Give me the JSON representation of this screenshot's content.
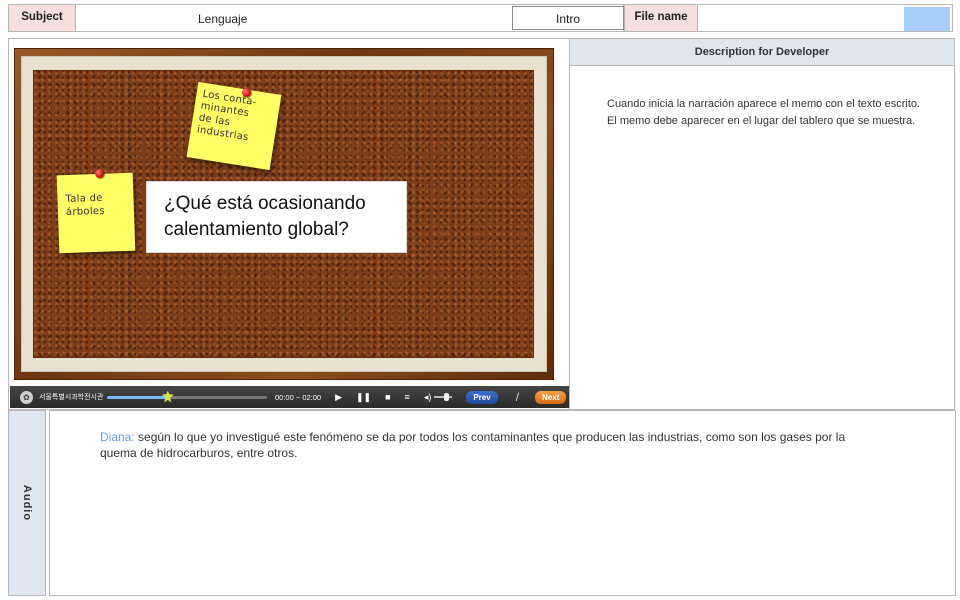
{
  "header": {
    "subject_label": "Subject",
    "subject_value": "Lenguaje",
    "screen_name": "Intro",
    "file_label": "File name",
    "file_value": "",
    "file_swatch_color": "#a9cdf7"
  },
  "board": {
    "note_industries": "Los conta-\nminantes\nde las\nindustrias",
    "note_trees": "Tala de\nárboles",
    "question": "¿Qué está ocasionando\ncalentamiento global?"
  },
  "player": {
    "logo_text": "서울특별시과학전시관",
    "time": "00:00 ~ 02:00",
    "play_icon": "▶",
    "pause_icon": "❚❚",
    "stop_icon": "■",
    "menu_icon": "≡",
    "volume_icon": "◂)",
    "prev_label": "Prev",
    "separator": "/",
    "next_label": "Next",
    "progress": 0.38
  },
  "description": {
    "title": "Description for Developer",
    "line1": "Cuando inicia la narración aparece el memo con el texto escrito.",
    "line2": "El memo debe aparecer en el lugar del tablero que se muestra."
  },
  "audio": {
    "label": "Audio",
    "speaker": "Diana:",
    "text": " según lo que yo investigué este fenómeno se da  por todos los contaminantes que producen  las industrias, como son los gases por la quema de hidrocarburos, entre otros."
  }
}
